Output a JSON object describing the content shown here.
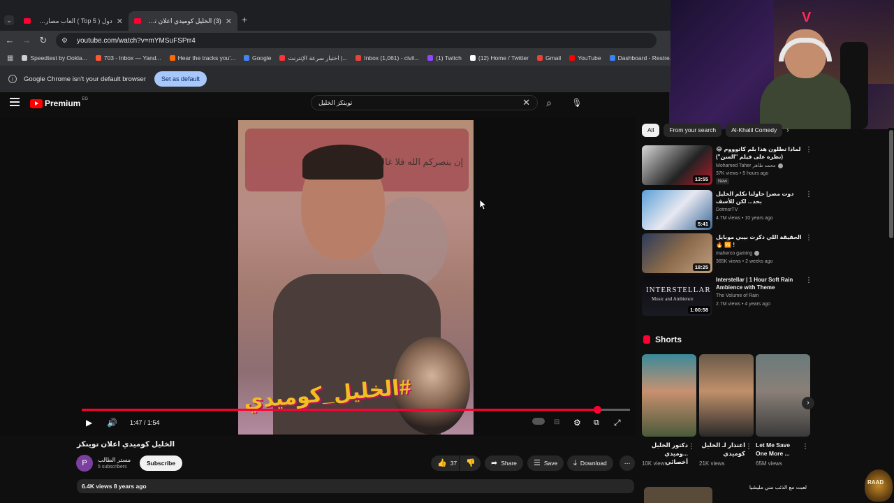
{
  "browser": {
    "tabs": [
      {
        "title": "دول ( Top 5 ) العاب مصارعه نزلوا"
      },
      {
        "title": "(3) الخليل كوميدي اعلان توينكز - -"
      }
    ],
    "url": "youtube.com/watch?v=mYMSuFSPrr4",
    "bookmarks": [
      {
        "label": "Speedtest by Ookla...",
        "color": "#cfcfcf"
      },
      {
        "label": "703 - Inbox — Yand...",
        "color": "#ff5533"
      },
      {
        "label": "Hear the tracks you'...",
        "color": "#ff6a00"
      },
      {
        "label": "Google",
        "color": "#4285f4"
      },
      {
        "label": "اختبار سرعة الإنترنت |...",
        "color": "#ff3333"
      },
      {
        "label": "Inbox (1,061) - civil...",
        "color": "#ea4335"
      },
      {
        "label": "(1) Twitch",
        "color": "#9146ff"
      },
      {
        "label": "(12) Home / Twitter",
        "color": "#ffffff"
      },
      {
        "label": "Gmail",
        "color": "#ea4335"
      },
      {
        "label": "YouTube",
        "color": "#ff0000"
      },
      {
        "label": "Dashboard - Restre...",
        "color": "#3b82f6"
      }
    ],
    "default_bar": {
      "message": "Google Chrome isn't your default browser",
      "button": "Set as default"
    }
  },
  "youtube": {
    "logo": {
      "word": "Premium",
      "country": "EG"
    },
    "search": {
      "query": "توينكز الخليل",
      "clear": "✕"
    },
    "player": {
      "time": "1:47 / 1:54",
      "progress": 0.94,
      "overlay_hashtag": "#الخليل_كوميدي",
      "poster_text": "إن ينصركم الله فلا غالب لكم"
    },
    "video": {
      "title": "الخليل كوميدي اعلان توينكز",
      "channel": "مستر الطالب",
      "avatar_letter": "P",
      "subscribers": "5 subscribers",
      "subscribe": "Subscribe",
      "likes": "37",
      "share": "Share",
      "save": "Save",
      "download": "Download",
      "views_date": "6.4K views  8 years ago"
    },
    "chips": [
      "All",
      "From your search",
      "Al-Khalil Comedy"
    ],
    "recommendations": [
      {
        "title": "لماذا تطلون هذا بلم كاتوووم 😂 (نظره على فيلم \"السن\")",
        "channel": "Mohamed Taher محمد طاهر",
        "views": "37K views • 5 hours ago",
        "duration": "13:55",
        "badge": "New",
        "rtl": true
      },
      {
        "title": "دوت مصر| حاولنا نكلم الخليل بحد... لكن للأسف",
        "channel": "DotmsrTV",
        "views": "4.7M views • 10 years ago",
        "duration": "5:41",
        "rtl": true
      },
      {
        "title": "الحقيقة اللي دكرت بيبي موبايل ! 🆚 🔥",
        "channel": "maherco gaming",
        "views": "365K views • 2 weeks ago",
        "duration": "18:25",
        "rtl": true
      },
      {
        "title": "Interstellar | 1 Hour Soft Rain Ambience with Theme",
        "channel": "The Volume of Rain",
        "views": "2.7M views • 4 years ago",
        "duration": "1:00:58",
        "thumb_text1": "INTERSTELLAR",
        "thumb_text2": "Music and Ambience",
        "rtl": false
      }
    ],
    "shorts": {
      "heading": "Shorts",
      "items": [
        {
          "title": "دكتور الخليل ...وميدي أخصائي",
          "views": "10K views"
        },
        {
          "title": "اعتذار لـ الخليل كوميدي",
          "views": "21K views"
        },
        {
          "title": "Let Me Save One More ...",
          "views": "65M views"
        }
      ]
    },
    "next_rec_title": "لعبت مع الذئب مني مليشيا"
  },
  "overlay": {
    "badge": "RAAD"
  },
  "colors": {
    "accent": "#ff0033",
    "background": "#0f0f0f",
    "chip_bg": "#272727",
    "set_default_bg": "#a8c7fa"
  }
}
